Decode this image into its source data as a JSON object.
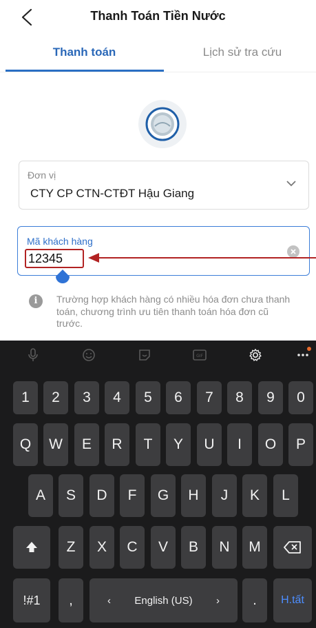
{
  "header": {
    "title": "Thanh Toán Tiền Nước",
    "back_icon": "chevron-left-icon"
  },
  "tabs": [
    {
      "label": "Thanh toán",
      "active": true
    },
    {
      "label": "Lịch sử tra cứu",
      "active": false
    }
  ],
  "unit": {
    "label": "Đơn vị",
    "value": "CTY CP CTN-CTĐT Hậu Giang"
  },
  "customer_code": {
    "label": "Mã khách hàng",
    "value": "12345"
  },
  "info": {
    "icon": "info-icon",
    "text": "Trường hợp khách hàng có nhiều hóa đơn chưa thanh toán, chương trình ưu tiên thanh toán hóa đơn cũ trước."
  },
  "keyboard": {
    "toolbar_icons": [
      "microphone-icon",
      "emoji-icon",
      "sticker-icon",
      "gif-icon",
      "gear-icon",
      "more-icon"
    ],
    "number_row": [
      "1",
      "2",
      "3",
      "4",
      "5",
      "6",
      "7",
      "8",
      "9",
      "0"
    ],
    "row1": [
      "Q",
      "W",
      "E",
      "R",
      "T",
      "Y",
      "U",
      "I",
      "O",
      "P"
    ],
    "row2": [
      "A",
      "S",
      "D",
      "F",
      "G",
      "H",
      "J",
      "K",
      "L"
    ],
    "row3": [
      "Z",
      "X",
      "C",
      "V",
      "B",
      "N",
      "M"
    ],
    "symbols_label": "!#1",
    "comma_label": ",",
    "period_label": ".",
    "space_label": "English (US)",
    "space_left": "‹",
    "space_right": "›",
    "enter_label": "H.tất"
  },
  "colors": {
    "accent": "#2a6fc4",
    "annotation": "#b22222",
    "keyboard_bg": "#1b1b1c",
    "key_bg": "#3d3d3f"
  }
}
